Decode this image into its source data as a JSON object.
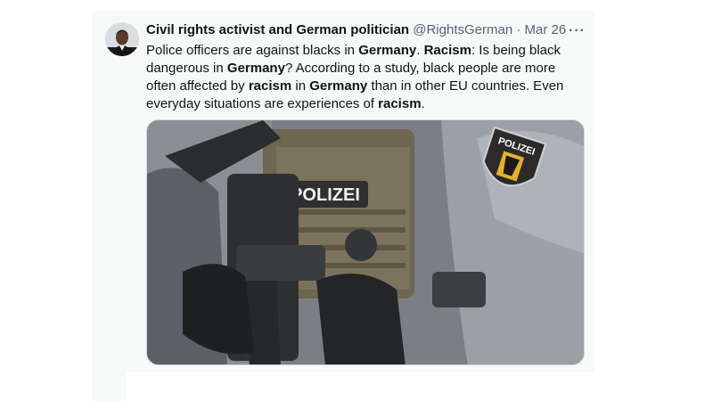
{
  "tweet": {
    "author_name": "Civil rights activist and German politician",
    "handle": "@RightsGerman",
    "separator": " · ",
    "date": "Mar 26",
    "more_label": "···",
    "text_segments": [
      {
        "t": "Police officers are against blacks in ",
        "b": false
      },
      {
        "t": "Germany",
        "b": true
      },
      {
        "t": ". ",
        "b": false
      },
      {
        "t": "Racism",
        "b": true
      },
      {
        "t": ": Is being black dangerous in ",
        "b": false
      },
      {
        "t": "Germany",
        "b": true
      },
      {
        "t": "? According to a study, black people are more often affected by ",
        "b": false
      },
      {
        "t": "racism",
        "b": true
      },
      {
        "t": " in ",
        "b": false
      },
      {
        "t": "Germany",
        "b": true
      },
      {
        "t": " than in other EU countries. Even everyday situations are experiences of ",
        "b": false
      },
      {
        "t": "racism",
        "b": true
      },
      {
        "t": ".",
        "b": false
      }
    ],
    "media": {
      "vest_label": "POLIZEI",
      "patch_label": "POLIZEI"
    }
  }
}
